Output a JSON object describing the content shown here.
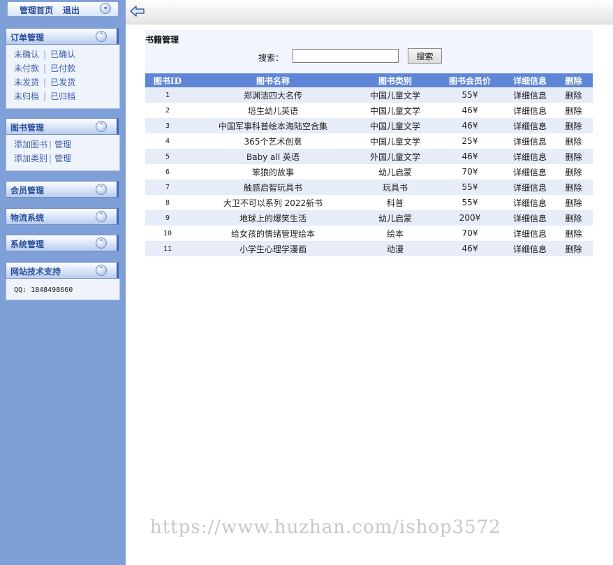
{
  "topbar": {
    "home": "管理首页",
    "logout": "退出"
  },
  "sidebar": {
    "order": {
      "title": "订单管理",
      "rows": [
        [
          "未确认",
          "已确认"
        ],
        [
          "未付款",
          "已付款"
        ],
        [
          "未发货",
          "已发货"
        ],
        [
          "未归档",
          "已归档"
        ]
      ]
    },
    "books": {
      "title": "图书管理",
      "rows": [
        [
          "添加图书",
          "管理"
        ],
        [
          "添加类别",
          "管理"
        ]
      ]
    },
    "members": {
      "title": "会员管理"
    },
    "logistics": {
      "title": "物流系统"
    },
    "system": {
      "title": "系统管理"
    },
    "support": {
      "title": "网站技术支持",
      "qq": "QQ: 1848498660"
    }
  },
  "main": {
    "title": "书籍管理",
    "search_label": "搜索：",
    "search_value": "",
    "search_button": "搜索",
    "columns": [
      "图书ID",
      "图书名称",
      "图书类别",
      "图书会员价",
      "详细信息",
      "删除"
    ],
    "rows": [
      {
        "id": "1",
        "name": "郑渊洁四大名传",
        "category": "中国儿童文学",
        "price": "55¥",
        "detail": "详细信息",
        "delete": "删除"
      },
      {
        "id": "2",
        "name": "培生幼儿英语",
        "category": "中国儿童文学",
        "price": "46¥",
        "detail": "详细信息",
        "delete": "删除"
      },
      {
        "id": "3",
        "name": "中国军事科普绘本海陆空合集",
        "category": "中国儿童文学",
        "price": "46¥",
        "detail": "详细信息",
        "delete": "删除"
      },
      {
        "id": "4",
        "name": "365个艺术创意",
        "category": "中国儿童文学",
        "price": "25¥",
        "detail": "详细信息",
        "delete": "删除"
      },
      {
        "id": "5",
        "name": "Baby all 英语",
        "category": "外国儿童文学",
        "price": "46¥",
        "detail": "详细信息",
        "delete": "删除"
      },
      {
        "id": "6",
        "name": "笨狼的故事",
        "category": "幼儿启蒙",
        "price": "70¥",
        "detail": "详细信息",
        "delete": "删除"
      },
      {
        "id": "7",
        "name": "触感启智玩具书",
        "category": "玩具书",
        "price": "55¥",
        "detail": "详细信息",
        "delete": "删除"
      },
      {
        "id": "8",
        "name": "大卫不可以系列 2022新书",
        "category": "科普",
        "price": "55¥",
        "detail": "详细信息",
        "delete": "删除"
      },
      {
        "id": "9",
        "name": "地球上的爆笑生活",
        "category": "幼儿启蒙",
        "price": "200¥",
        "detail": "详细信息",
        "delete": "删除"
      },
      {
        "id": "10",
        "name": "给女孩的情绪管理绘本",
        "category": "绘本",
        "price": "70¥",
        "detail": "详细信息",
        "delete": "删除"
      },
      {
        "id": "11",
        "name": "小学生心理学漫画",
        "category": "动漫",
        "price": "46¥",
        "detail": "详细信息",
        "delete": "删除"
      }
    ]
  },
  "watermark": "https://www.huzhan.com/ishop3572",
  "colors": {
    "sidebar_bg": "#7f9fd8",
    "table_header": "#5f86d6",
    "link": "#3b5da8"
  }
}
